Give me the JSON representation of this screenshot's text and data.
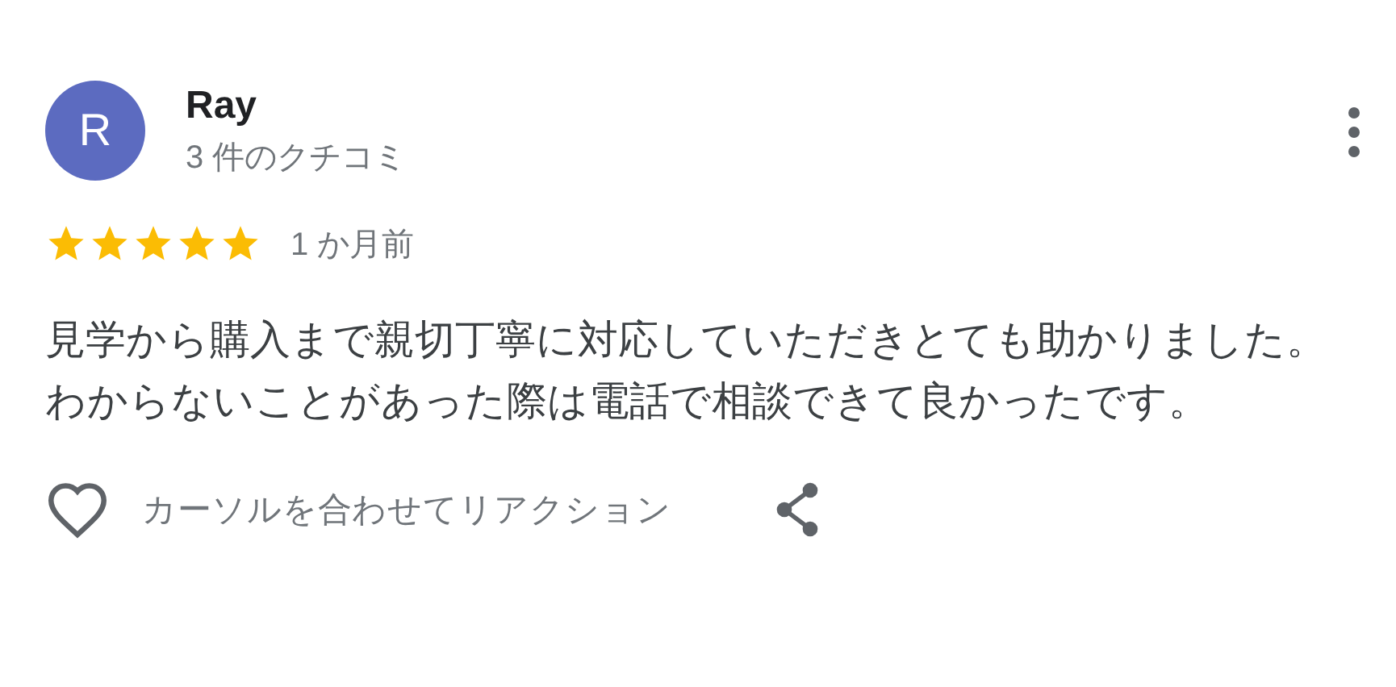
{
  "review": {
    "avatar_letter": "R",
    "author": "Ray",
    "review_count": "3 件のクチコミ",
    "stars": 5,
    "time": "1 か月前",
    "body": [
      "見学から購入まで親切丁寧に対応していただきとても助かりました。",
      "わからないことがあった際は電話で相談できて良かったです。"
    ],
    "reaction_label": "カーソルを合わせてリアクション"
  }
}
